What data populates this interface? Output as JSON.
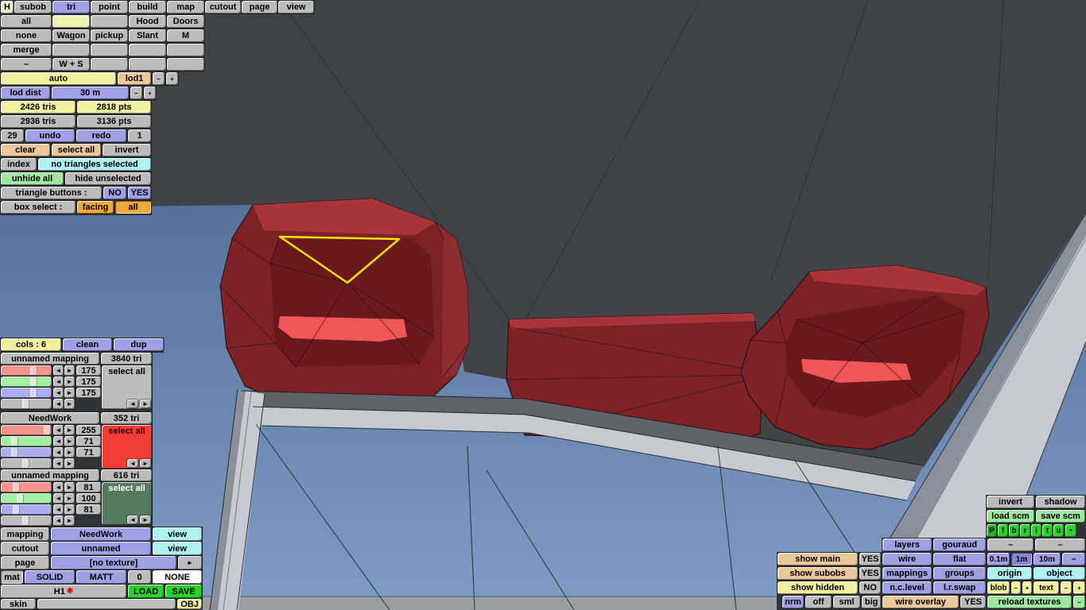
{
  "colors": {
    "accent_select": "#f5e400",
    "mesh_red": "#7c2226",
    "mesh_red_deep": "#69181c",
    "mesh_red_light": "#a83338",
    "mesh_red_glow": "#ef5658",
    "vp_bg": "#3f4347",
    "sky_top": "#557199",
    "sky_bottom": "#7f9cc4",
    "frame_light": "#c7cbd1",
    "frame_mid": "#8a9099",
    "frame_dark": "#5d636b",
    "ground": "#989ea6",
    "panel_gap": "#303338",
    "wire": "#16181c"
  },
  "t1": [
    "H",
    "subob",
    "tri",
    "point",
    "build",
    "map",
    "cutout",
    "page",
    "view"
  ],
  "t2": [
    "all",
    "Hood",
    "Doors"
  ],
  "t3": [
    "none",
    "Wagon",
    "pickup",
    "Slant",
    "M"
  ],
  "t4": [
    "merge"
  ],
  "t5": [
    "–",
    "W + S"
  ],
  "lod": {
    "auto": "auto",
    "lod1": "lod1",
    "minus": "–",
    "plus": "+"
  },
  "dist": {
    "label": "lod dist",
    "value": "30 m",
    "minus": "–",
    "plus": "+"
  },
  "stats": {
    "tris_lod": "2426 tris",
    "pts_lod": "2818 pts",
    "tris_total": "2936 tris",
    "pts_total": "3136 pts"
  },
  "hist": {
    "count": "29",
    "undo": "undo",
    "redo": "redo",
    "depth": "1"
  },
  "sel": {
    "clear": "clear",
    "select_all": "select all",
    "invert": "invert",
    "index": "index",
    "status": "no triangles selected",
    "unhide_all": "unhide all",
    "hide_unselected": "hide unselected",
    "tb_label": "triangle buttons :",
    "no": "NO",
    "yes": "YES",
    "bs_label": "box select :",
    "facing": "facing",
    "all": "all"
  },
  "cols": {
    "label": "cols : 6",
    "clean": "clean",
    "dup": "dup"
  },
  "arrows": {
    "left": "◄",
    "right": "►"
  },
  "sections": [
    {
      "name": "unnamed mapping",
      "tri": "3840 tri",
      "r": "175",
      "g": "175",
      "b": "175",
      "select": "select all"
    },
    {
      "name": "NeedWork",
      "tri": "352 tri",
      "r": "255",
      "g": "71",
      "b": "71",
      "select": "select all"
    },
    {
      "name": "unnamed mapping",
      "tri": "616 tri",
      "r": "81",
      "g": "100",
      "b": "81",
      "select": "select all"
    }
  ],
  "bl": {
    "mapping": "mapping",
    "mapping_value": "NeedWork",
    "view1": "view",
    "cutout": "cutout",
    "cutout_value": "unnamed",
    "view2": "view",
    "page": "page",
    "page_value": "[no texture]",
    "next": "►",
    "mat": "mat",
    "solid": "SOLID",
    "matt": "MATT",
    "zero": "0",
    "none": "NONE",
    "h1": "H1",
    "star": "✱",
    "load": "LOAD",
    "save": "SAVE",
    "skin": "skin",
    "obj": "OBJ"
  },
  "vis": {
    "show_main": "show main",
    "show_main_v": "YES",
    "show_subobs": "show subobs",
    "show_subobs_v": "YES",
    "show_hidden": "show hidden",
    "show_hidden_v": "NO",
    "nrm": "nrm",
    "off": "off",
    "sml": "sml",
    "big": "big"
  },
  "scm": {
    "invert": "invert",
    "shadow": "shadow",
    "load": "load scm",
    "save": "save scm",
    "p": "P",
    "f": "f",
    "b": "b",
    "r": "r",
    "l": "l",
    "t": "t",
    "u": "u",
    "dot": "●"
  },
  "grid": {
    "layers": "layers",
    "gouraud": "gouraud",
    "dashA1": "–",
    "dashA2": "–",
    "wire": "wire",
    "flat": "flat",
    "m01": "0.1m",
    "m1": "1m",
    "m10": "10m",
    "dashB": "–",
    "mappings": "mappings",
    "groups": "groups",
    "origin": "origin",
    "object": "object",
    "nclevel": "n.c.level",
    "lrswap": "l.r.swap",
    "blob": "blob",
    "blob_minus": "–",
    "blob_plus": "+",
    "text": "text",
    "text_minus": "–",
    "text_plus": "+",
    "overlay": "wire overlay",
    "overlay_v": "YES",
    "reload": "reload textures",
    "reload_minus": "–"
  }
}
